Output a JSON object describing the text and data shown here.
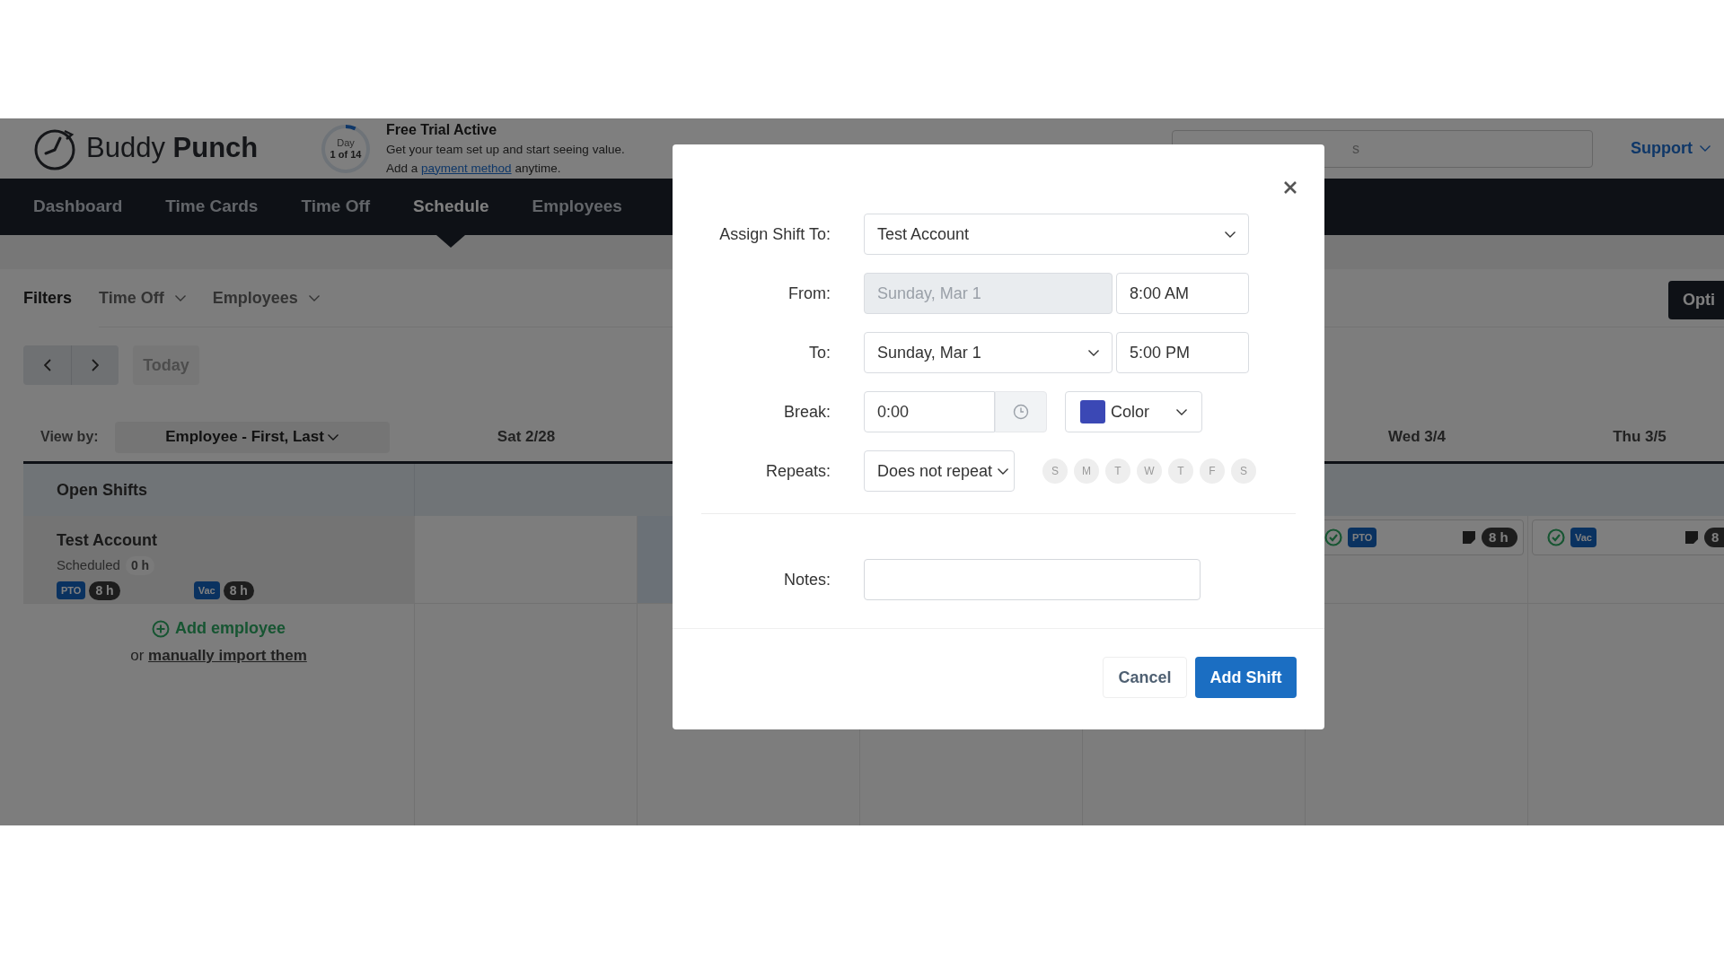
{
  "header": {
    "logo": {
      "first": "Buddy",
      "second": "Punch"
    },
    "trial": {
      "day_label": "Day",
      "day_count": "1 of 14",
      "level": 0.07,
      "title": "Free Trial Active",
      "line1": "Get your team set up and start seeing value.",
      "line2": {
        "before": "Add a",
        "link": "payment method",
        "after": "anytime."
      }
    },
    "search": {
      "placeholder": "s"
    },
    "support": "Support"
  },
  "nav": [
    {
      "label": "Dashboard",
      "selected": false
    },
    {
      "label": "Time Cards",
      "selected": false
    },
    {
      "label": "Time Off",
      "selected": false
    },
    {
      "label": "Schedule",
      "selected": true
    },
    {
      "label": "Employees",
      "selected": false
    }
  ],
  "filters": {
    "label": "Filters",
    "dropdowns": [
      "Time Off",
      "Employees"
    ],
    "options_button": "Opti"
  },
  "toolbar": {
    "today": "Today",
    "today_disabled": true
  },
  "view_by": {
    "label": "View by:",
    "value": "Employee - First, Last"
  },
  "columns": [
    {
      "header": "Sat 2/28"
    },
    {
      "tinted": true
    },
    {},
    {},
    {
      "header": "Wed 3/4"
    },
    {
      "header": "Thu 3/5"
    }
  ],
  "open_shifts": "Open Shifts",
  "employee": {
    "name": "Test Account",
    "scheduled_label": "Scheduled",
    "scheduled_hours": "0 h",
    "badges": [
      {
        "code": "PTO",
        "hours": "8 h"
      },
      {
        "code": "Vac",
        "hours": "8 h"
      }
    ],
    "cells": [
      {},
      {},
      {},
      {},
      {
        "entry": {
          "code": "PTO",
          "hours": "8 h"
        }
      },
      {
        "entry": {
          "code": "Vac",
          "hours": "8"
        }
      }
    ]
  },
  "add_employee": {
    "label": "Add employee",
    "or": "or",
    "link": "manually import them"
  },
  "modal": {
    "assign": {
      "label": "Assign Shift To:",
      "value": "Test Account"
    },
    "from": {
      "label": "From:",
      "date": "Sunday, Mar 1",
      "date_disabled": true,
      "time": "8:00 AM"
    },
    "to": {
      "label": "To:",
      "date": "Sunday, Mar 1",
      "date_disabled": false,
      "time": "5:00 PM"
    },
    "break": {
      "label": "Break:",
      "value": "0:00"
    },
    "color": {
      "label": "Color",
      "color": "#3b48b5"
    },
    "repeats": {
      "label": "Repeats:",
      "value": "Does not repeat",
      "days": [
        {
          "letter": "S",
          "selected": false
        },
        {
          "letter": "M",
          "selected": false
        },
        {
          "letter": "T",
          "selected": false
        },
        {
          "letter": "W",
          "selected": false
        },
        {
          "letter": "T",
          "selected": false
        },
        {
          "letter": "F",
          "selected": false
        },
        {
          "letter": "S",
          "selected": false
        }
      ]
    },
    "notes": {
      "label": "Notes:"
    },
    "buttons": {
      "cancel": "Cancel",
      "submit": "Add Shift"
    }
  }
}
